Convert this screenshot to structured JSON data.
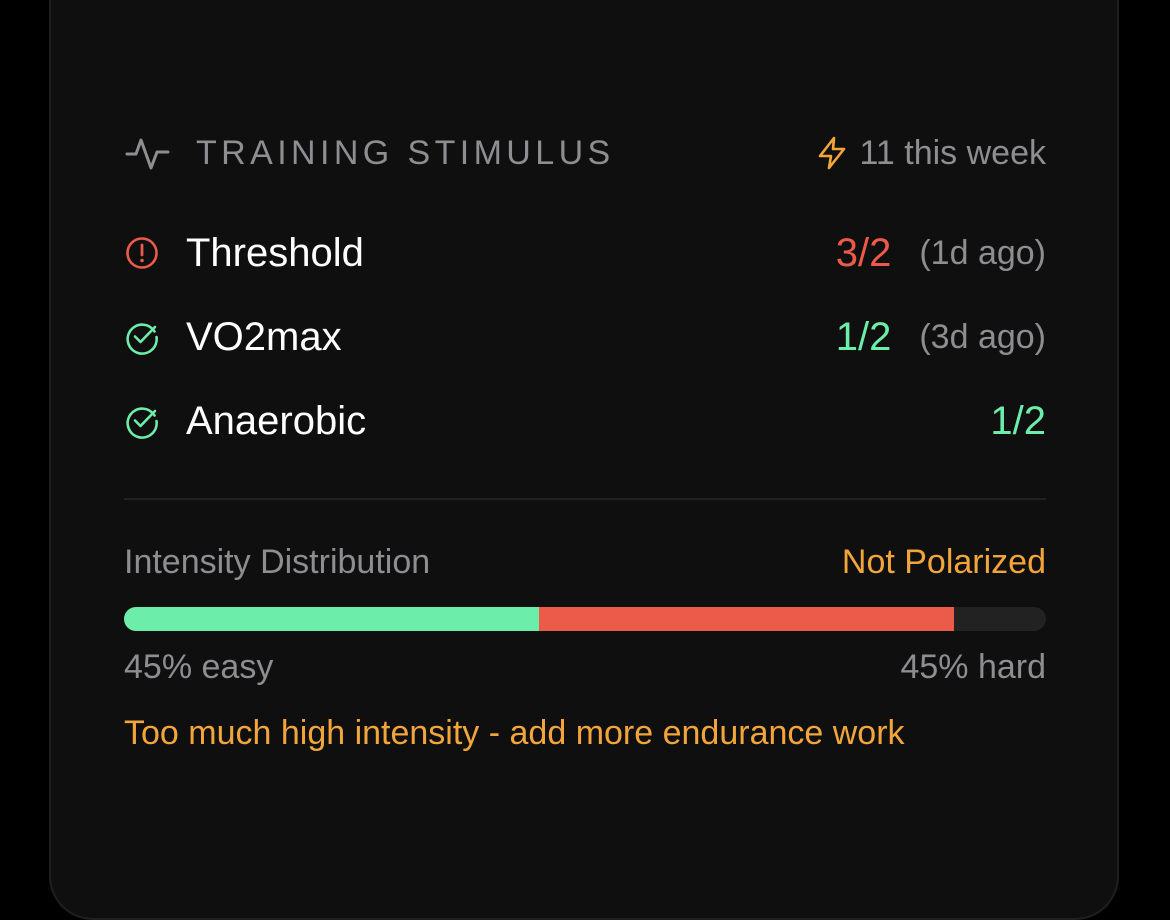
{
  "colors": {
    "background": "#000000",
    "card": "#0f0f0f",
    "muted": "#8d8d92",
    "green": "#6dedaa",
    "red": "#ec5a4a",
    "orange": "#f2a53a"
  },
  "header": {
    "icon": "activity-icon",
    "title": "TRAINING STIMULUS",
    "week_icon": "lightning-bolt-icon",
    "week_text": "11 this week"
  },
  "stimulus": [
    {
      "label": "Threshold",
      "icon": "alert-circle-icon",
      "status": "over",
      "value": "3/2",
      "ago": "(1d ago)"
    },
    {
      "label": "VO2max",
      "icon": "check-circle-icon",
      "status": "ok",
      "value": "1/2",
      "ago": "(3d ago)"
    },
    {
      "label": "Anaerobic",
      "icon": "check-circle-icon",
      "status": "ok",
      "value": "1/2",
      "ago": ""
    }
  ],
  "distribution": {
    "title": "Intensity Distribution",
    "status": "Not Polarized",
    "easy_percent": 45,
    "hard_percent": 45,
    "easy_label": "45% easy",
    "hard_label": "45% hard",
    "advice": "Too much high intensity - add more endurance work"
  }
}
